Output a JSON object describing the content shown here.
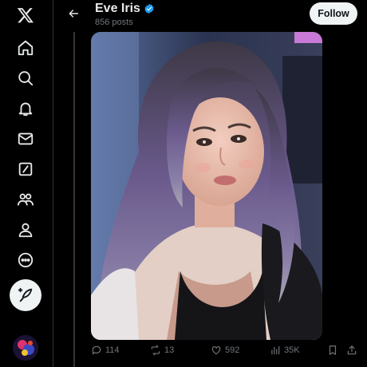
{
  "header": {
    "title": "Eve Iris",
    "subtitle": "856 posts",
    "follow_label": "Follow"
  },
  "sidebar": {
    "icons": [
      "x-logo-icon",
      "home-icon",
      "search-icon",
      "notifications-icon",
      "messages-icon",
      "grok-icon",
      "communities-icon",
      "profile-icon",
      "more-icon",
      "compose-icon"
    ]
  },
  "post": {
    "replies": "114",
    "reposts": "13",
    "likes": "592",
    "views": "35K"
  },
  "colors": {
    "verified": "#1d9bf0",
    "muted": "#71767b",
    "accent": "#eff3f4"
  }
}
